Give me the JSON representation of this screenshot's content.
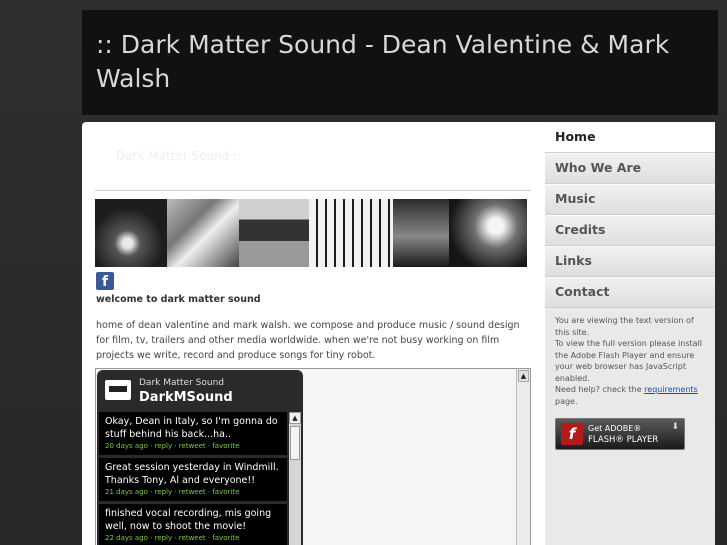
{
  "header": {
    "title": ":: Dark Matter Sound - Dean Valentine & Mark Walsh"
  },
  "main": {
    "page_caption": "Dark Matter Sound ::",
    "facebook_icon": "facebook-icon",
    "welcome": "welcome to dark matter sound",
    "intro": "home of dean valentine and mark walsh. we compose and produce music / sound design for film, tv, trailers and other media worldwide. when we're not busy working on film projects we write, record and produce songs for tiny robot."
  },
  "twitter": {
    "name": "Dark Matter Sound",
    "handle": "DarkMSound",
    "tweets": [
      {
        "text": "Okay, Dean in Italy, so I'm gonna do stuff behind his back...ha..",
        "meta": "20 days ago · reply · retweet · favorite"
      },
      {
        "text": "Great session yesterday in Windmill. Thanks Tony, Al and everyone!!",
        "meta": "21 days ago · reply · retweet · favorite"
      },
      {
        "text": "finished vocal recording, mis going well, now to shoot the movie!",
        "meta": "22 days ago · reply · retweet · favorite"
      }
    ]
  },
  "nav": {
    "items": [
      {
        "label": "Home"
      },
      {
        "label": "Who We Are"
      },
      {
        "label": "Music"
      },
      {
        "label": "Credits"
      },
      {
        "label": "Links"
      },
      {
        "label": "Contact"
      }
    ],
    "note_text": "You are viewing the text version of this site.\nTo view the full version please install the Adobe Flash Player and ensure your web browser has JavaScript enabled.\nNeed help? check the ",
    "note_link": "requirements",
    "note_end": "page.",
    "flash_button": {
      "line1": "Get ADOBE®",
      "line2": "FLASH® PLAYER"
    }
  },
  "colors": {
    "accent": "#7acb3a",
    "header_bg": "#111111",
    "link": "#1b4f9c"
  }
}
